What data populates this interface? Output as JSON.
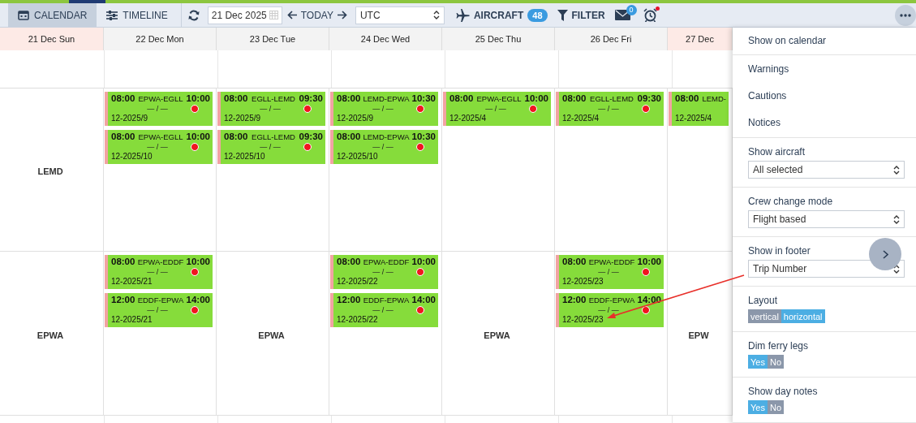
{
  "toolbar": {
    "views": [
      {
        "kind": "calendar",
        "label": "CALENDAR",
        "selected": true
      },
      {
        "kind": "timeline",
        "label": "TIMELINE",
        "selected": false
      }
    ],
    "date": "21 Dec 2025",
    "today": "TODAY",
    "timezone": "UTC",
    "aircraft": {
      "label": "AIRCRAFT",
      "count": "48"
    },
    "filter": "FILTER",
    "messages": "0",
    "alarm_alert": true
  },
  "days": [
    {
      "label": "21 Dec Sun",
      "highlighted": true
    },
    {
      "label": "22 Dec Mon",
      "highlighted": false
    },
    {
      "label": "23 Dec Tue",
      "highlighted": false
    },
    {
      "label": "24 Dec Wed",
      "highlighted": false
    },
    {
      "label": "25 Dec Thu",
      "highlighted": false
    },
    {
      "label": "26 Dec Fri",
      "highlighted": false
    },
    {
      "label": "27 Dec",
      "highlighted": true
    }
  ],
  "rows": [
    {
      "cells": [
        {
          "label": "LEMD"
        },
        {
          "flights": [
            {
              "dep": "08:00",
              "route": "EPWA-EGLL",
              "arr": "10:00",
              "crew": "— / —",
              "trip": "12-2025/9"
            },
            {
              "dep": "08:00",
              "route": "EPWA-EGLL",
              "arr": "10:00",
              "crew": "— / —",
              "trip": "12-2025/10"
            }
          ]
        },
        {
          "flights": [
            {
              "dep": "08:00",
              "route": "EGLL-LEMD",
              "arr": "09:30",
              "crew": "— / —",
              "trip": "12-2025/9"
            },
            {
              "dep": "08:00",
              "route": "EGLL-LEMD",
              "arr": "09:30",
              "crew": "— / —",
              "trip": "12-2025/10"
            }
          ]
        },
        {
          "flights": [
            {
              "dep": "08:00",
              "route": "LEMD-EPWA",
              "arr": "10:30",
              "crew": "— / —",
              "trip": "12-2025/9"
            },
            {
              "dep": "08:00",
              "route": "LEMD-EPWA",
              "arr": "10:30",
              "crew": "— / —",
              "trip": "12-2025/10"
            }
          ]
        },
        {
          "flights": [
            {
              "dep": "08:00",
              "route": "EPWA-EGLL",
              "arr": "10:00",
              "crew": "— / —",
              "trip": "12-2025/4"
            }
          ]
        },
        {
          "flights": [
            {
              "dep": "08:00",
              "route": "EGLL-LEMD",
              "arr": "09:30",
              "crew": "— / —",
              "trip": "12-2025/4"
            }
          ]
        },
        {
          "flights": [
            {
              "dep": "08:00",
              "route": "LEMD-",
              "trip": "12-2025/4"
            }
          ]
        }
      ]
    },
    {
      "cells": [
        {
          "label": "EPWA"
        },
        {
          "flights": [
            {
              "dep": "08:00",
              "route": "EPWA-EDDF",
              "arr": "10:00",
              "crew": "— / —",
              "trip": "12-2025/21"
            },
            {
              "dep": "12:00",
              "route": "EDDF-EPWA",
              "arr": "14:00",
              "crew": "— / —",
              "trip": "12-2025/21"
            }
          ]
        },
        {
          "label": "EPWA"
        },
        {
          "flights": [
            {
              "dep": "08:00",
              "route": "EPWA-EDDF",
              "arr": "10:00",
              "crew": "— / —",
              "trip": "12-2025/22"
            },
            {
              "dep": "12:00",
              "route": "EDDF-EPWA",
              "arr": "14:00",
              "crew": "— / —",
              "trip": "12-2025/22"
            }
          ]
        },
        {
          "label": "EPWA"
        },
        {
          "flights": [
            {
              "dep": "08:00",
              "route": "EPWA-EDDF",
              "arr": "10:00",
              "crew": "— / —",
              "trip": "12-2025/23"
            },
            {
              "dep": "12:00",
              "route": "EDDF-EPWA",
              "arr": "14:00",
              "crew": "— / —",
              "trip": "12-2025/23"
            }
          ]
        },
        {
          "label": "EPW"
        }
      ]
    }
  ],
  "panel": [
    {
      "kind": "link",
      "label": "Show on calendar"
    },
    {
      "kind": "links",
      "items": [
        "Warnings",
        "Cautions",
        "Notices"
      ]
    },
    {
      "kind": "select",
      "label": "Show aircraft",
      "value": "All selected"
    },
    {
      "kind": "select",
      "label": "Crew change mode",
      "value": "Flight based"
    },
    {
      "kind": "select",
      "label": "Show in footer",
      "value": "Trip Number"
    },
    {
      "kind": "toggle",
      "label": "Layout",
      "options": [
        {
          "label": "vertical",
          "selected": false
        },
        {
          "label": "horizontal",
          "selected": true
        }
      ]
    },
    {
      "kind": "toggle",
      "label": "Dim ferry legs",
      "options": [
        {
          "label": "Yes",
          "selected": true
        },
        {
          "label": "No",
          "selected": false
        }
      ]
    },
    {
      "kind": "toggle",
      "label": "Show day notes",
      "options": [
        {
          "label": "Yes",
          "selected": true
        },
        {
          "label": "No",
          "selected": false
        }
      ]
    }
  ]
}
